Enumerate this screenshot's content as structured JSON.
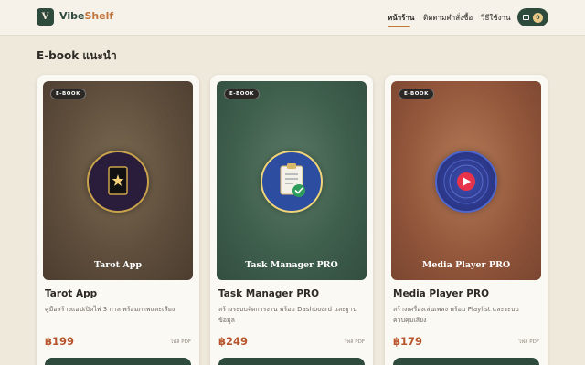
{
  "header": {
    "logo_letter": "V",
    "brand_part1": "Vibe",
    "brand_part2": "Shelf",
    "nav": [
      {
        "label": "หน้าร้าน",
        "active": true
      },
      {
        "label": "ติดตามคำสั่งซื้อ",
        "active": false
      },
      {
        "label": "วิธีใช้งาน",
        "active": false
      }
    ],
    "cart_count": "0"
  },
  "section_title": "E-book แนะนำ",
  "products": [
    {
      "badge": "E-BOOK",
      "cover_title": "Tarot App",
      "title": "Tarot App",
      "description": "คู่มือสร้างแอปเปิดไพ่ 3 กาล พร้อมภาพและเสียง",
      "price": "฿199",
      "file_type": "ไฟล์ PDF",
      "icon": "tarot-card-icon",
      "accent": "#c9a24c"
    },
    {
      "badge": "E-BOOK",
      "cover_title": "Task Manager PRO",
      "title": "Task Manager PRO",
      "description": "สร้างระบบจัดการงาน พร้อม Dashboard และฐานข้อมูล",
      "price": "฿249",
      "file_type": "ไฟล์ PDF",
      "icon": "clipboard-check-icon",
      "accent": "#2e9c5a"
    },
    {
      "badge": "E-BOOK",
      "cover_title": "Media Player PRO",
      "title": "Media Player PRO",
      "description": "สร้างเครื่องเล่นเพลง พร้อม Playlist และระบบควบคุมเสียง",
      "price": "฿179",
      "file_type": "ไฟล์ PDF",
      "icon": "play-button-icon",
      "accent": "#e8334a"
    }
  ]
}
